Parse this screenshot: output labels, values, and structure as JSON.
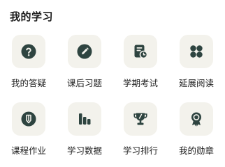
{
  "section": {
    "title": "我的学习"
  },
  "accent_color": "#2e4440",
  "tile_color": "#f3f2ec",
  "items": [
    {
      "label": "我的答疑",
      "icon": "question-icon"
    },
    {
      "label": "课后习题",
      "icon": "pencil-icon"
    },
    {
      "label": "学期考试",
      "icon": "exam-clock-icon"
    },
    {
      "label": "延展阅读",
      "icon": "grid-icon"
    },
    {
      "label": "课程作业",
      "icon": "pen-shield-icon"
    },
    {
      "label": "学习数据",
      "icon": "bar-chart-icon"
    },
    {
      "label": "学习排行",
      "icon": "trophy-icon"
    },
    {
      "label": "我的勋章",
      "icon": "medal-icon"
    }
  ]
}
